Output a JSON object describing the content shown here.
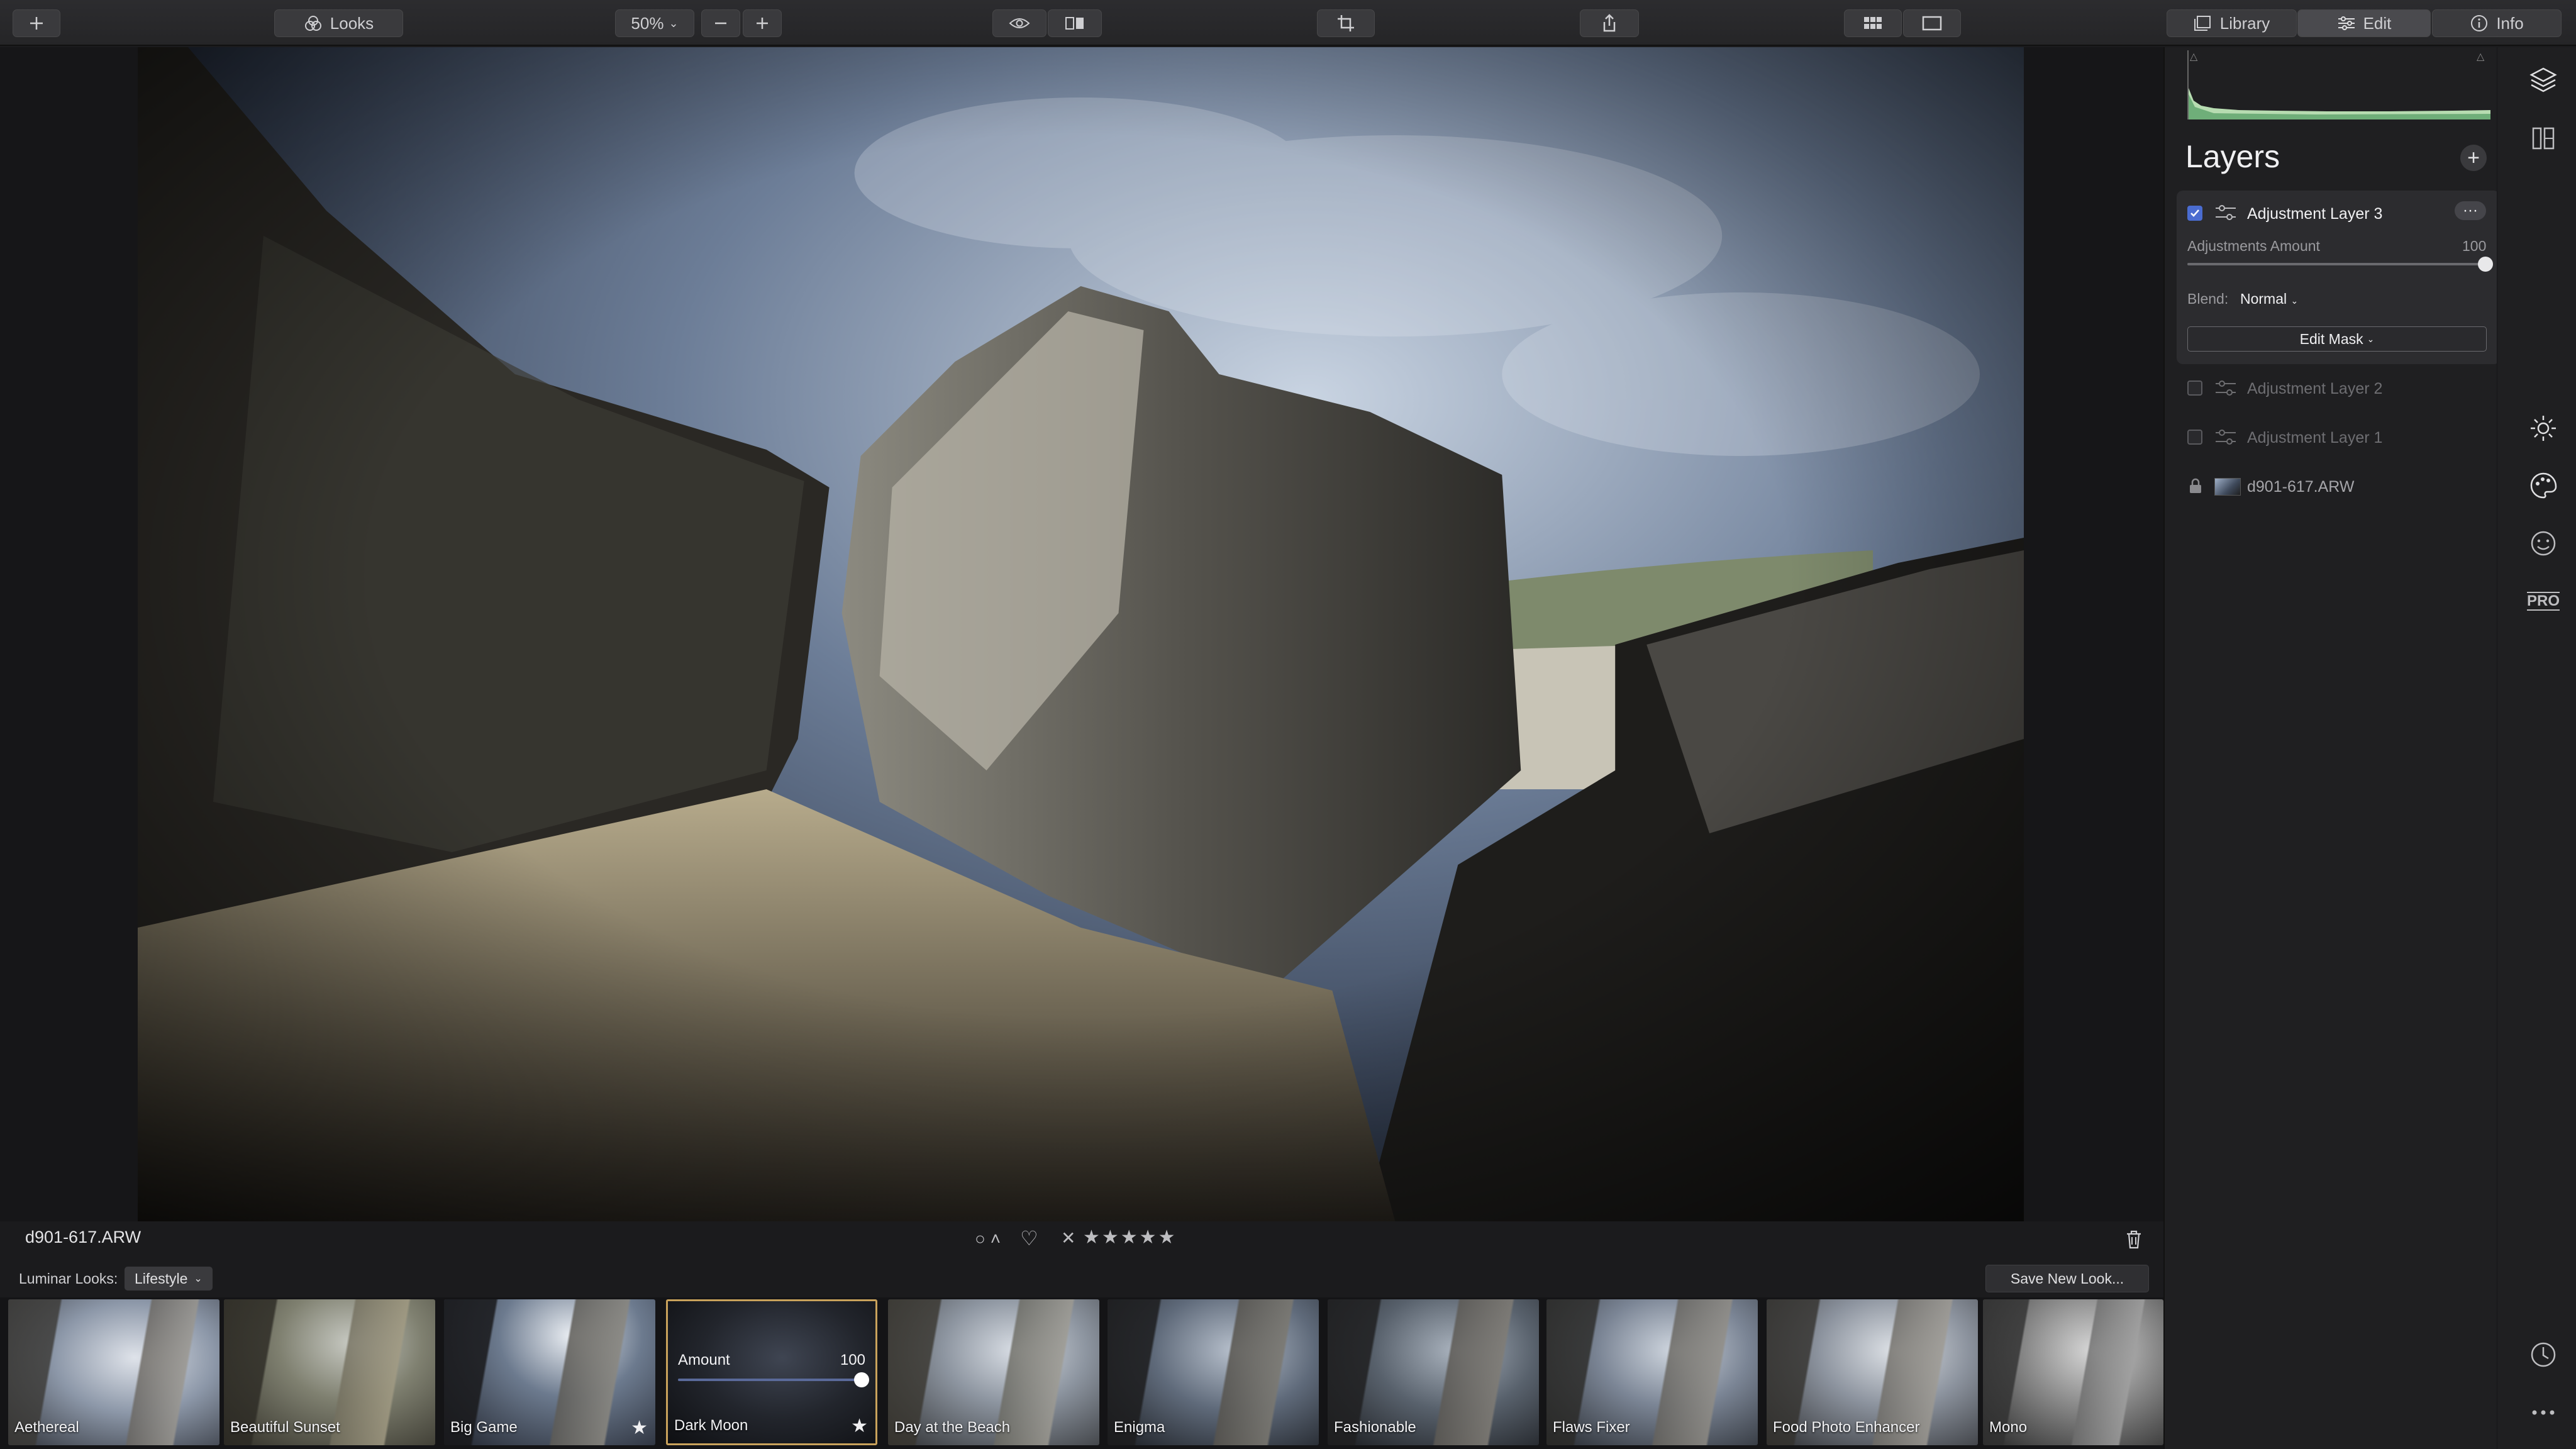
{
  "toolbar": {
    "looks_label": "Looks",
    "zoom_value": "50%",
    "tabs": [
      {
        "label": "Library"
      },
      {
        "label": "Edit"
      },
      {
        "label": "Info"
      }
    ]
  },
  "photo": {
    "filename": "d901-617.ARW"
  },
  "rating": {
    "flag": "○ ˄",
    "heart": "♡",
    "reject": "✕",
    "stars": "★★★★★"
  },
  "looks": {
    "label": "Luminar Looks:",
    "collection": "Lifestyle",
    "save_label": "Save New Look...",
    "amount_label": "Amount",
    "amount_value": "100",
    "items": [
      {
        "name": "Aethereal",
        "favorite": false
      },
      {
        "name": "Beautiful Sunset",
        "favorite": false
      },
      {
        "name": "Big Game",
        "favorite": true
      },
      {
        "name": "Dark Moon",
        "favorite": true,
        "active": true
      },
      {
        "name": "Day at the Beach",
        "favorite": false
      },
      {
        "name": "Enigma",
        "favorite": false
      },
      {
        "name": "Fashionable",
        "favorite": false
      },
      {
        "name": "Flaws Fixer",
        "favorite": false
      },
      {
        "name": "Food Photo Enhancer",
        "favorite": false
      },
      {
        "name": "Mono",
        "favorite": false
      }
    ]
  },
  "layers": {
    "title": "Layers",
    "items": [
      {
        "name": "Adjustment Layer 3",
        "checked": true
      },
      {
        "name": "Adjustment Layer 2",
        "checked": false
      },
      {
        "name": "Adjustment Layer 1",
        "checked": false
      },
      {
        "name": "d901-617.ARW",
        "locked": true
      }
    ],
    "adjustments_label": "Adjustments Amount",
    "adjustments_value": "100",
    "blend_label": "Blend:",
    "blend_value": "Normal",
    "edit_mask_label": "Edit Mask",
    "more_label": "···"
  },
  "side_tools": {
    "pro_label": "PRO"
  },
  "colors": {
    "accent": "#4a6cd0",
    "active_look_border": "#c9a25b"
  }
}
